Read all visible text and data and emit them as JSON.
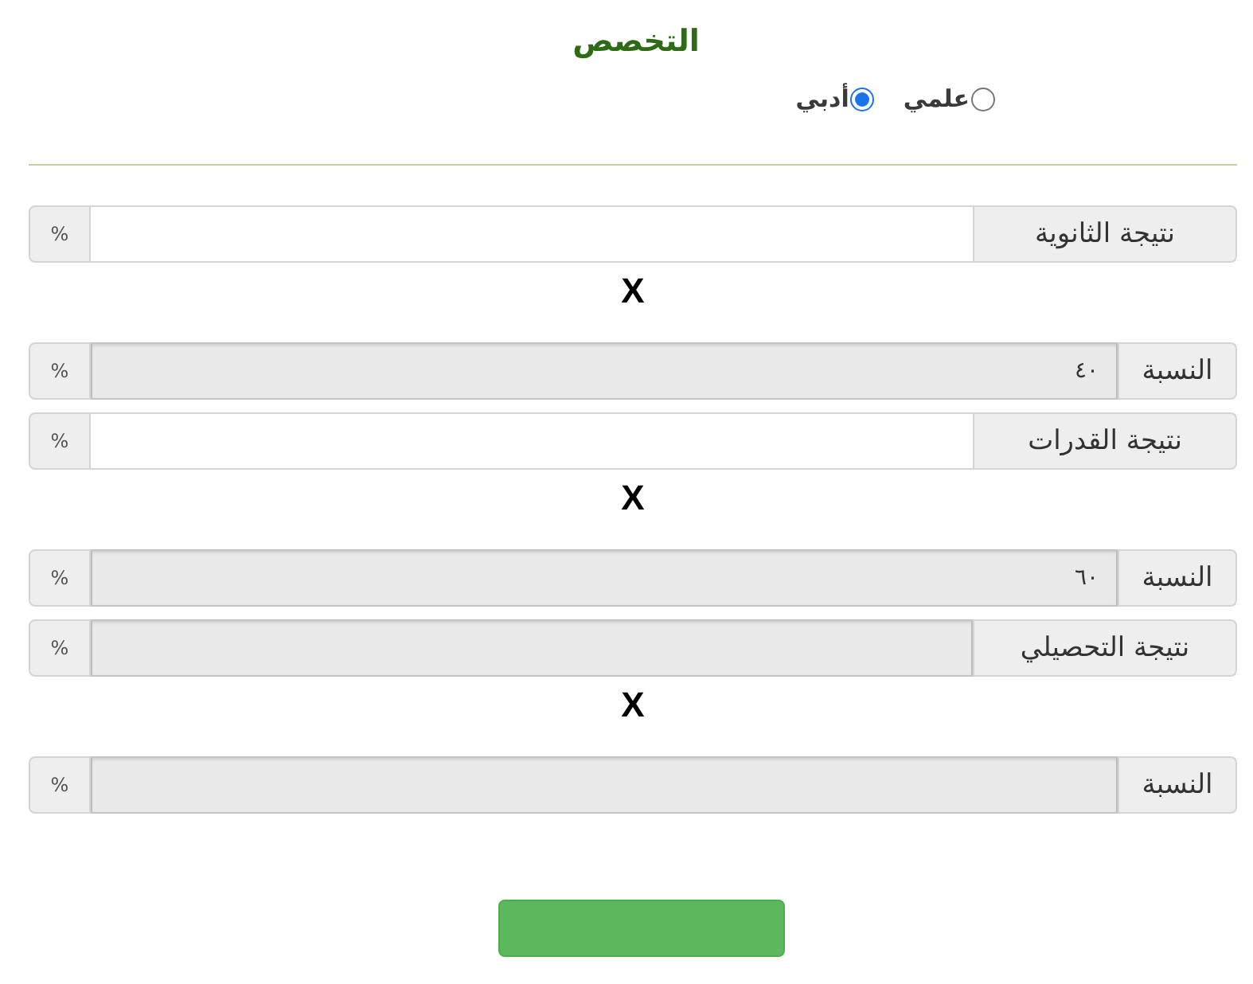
{
  "title": "التخصص",
  "specialization": [
    {
      "label": "علمي",
      "selected": false
    },
    {
      "label": "أدبي",
      "selected": true
    }
  ],
  "sections": [
    {
      "field": {
        "label": "نتيجة الثانوية",
        "disabled": false,
        "unit": "%"
      },
      "operator": "X",
      "weight": {
        "label": "النسبة",
        "value": "٤٠",
        "disabled": true,
        "unit": "%"
      }
    },
    {
      "field": {
        "label": "نتيجة القدرات",
        "disabled": false,
        "unit": "%"
      },
      "operator": "X",
      "weight": {
        "label": "النسبة",
        "value": "٦٠",
        "disabled": true,
        "unit": "%"
      }
    },
    {
      "field": {
        "label": "نتيجة التحصيلي",
        "disabled": true,
        "unit": "%"
      },
      "operator": "X",
      "weight": {
        "label": "النسبة",
        "disabled": true,
        "unit": "%"
      }
    }
  ]
}
